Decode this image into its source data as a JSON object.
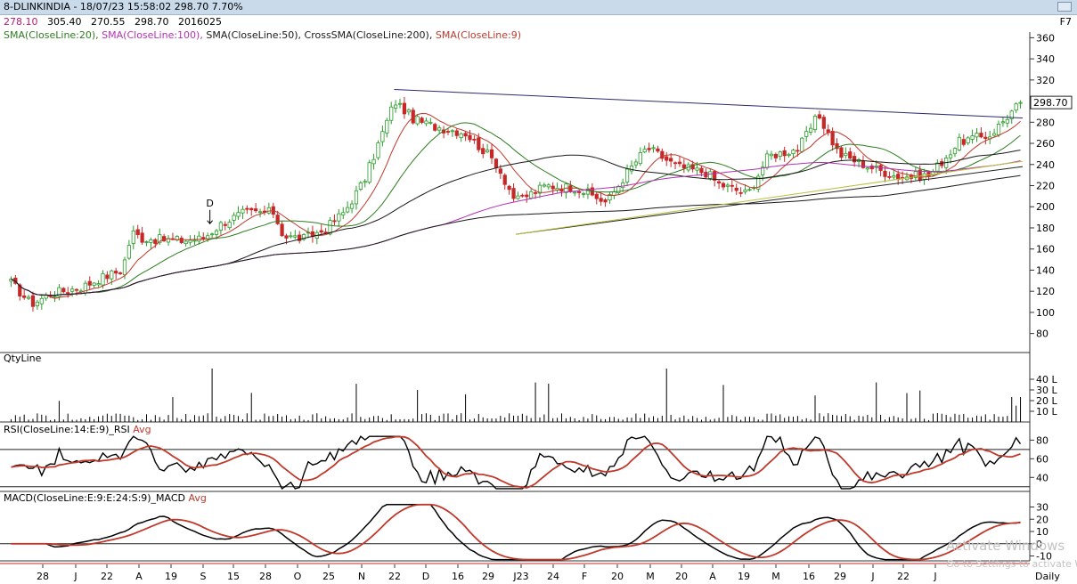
{
  "window": {
    "title": "8-DLINKINDIA - 18/07/23 15:58:02 298.70 7.70%"
  },
  "ohlc": {
    "open": "278.10",
    "high": "305.40",
    "low": "270.55",
    "close": "298.70",
    "volume": "2016025"
  },
  "shortcut": "F7",
  "indicators": [
    {
      "label": "SMA(CloseLine:20),",
      "color": "#2e7d1f"
    },
    {
      "label": "SMA(CloseLine:100),",
      "color": "#b531b5"
    },
    {
      "label": "SMA(CloseLine:50),",
      "color": "#1a1a1a"
    },
    {
      "label": "CrossSMA(CloseLine:200),",
      "color": "#1a1a1a"
    },
    {
      "label": "SMA(CloseLine:9)",
      "color": "#c0392b"
    }
  ],
  "panels": {
    "volume": "QtyLine",
    "rsi": {
      "name": "RSI(CloseLine:14:E:9)_RSI",
      "avg": "Avg"
    },
    "macd": {
      "name": "MACD(CloseLine:E:9:E:24:S:9)_MACD",
      "avg": "Avg"
    }
  },
  "annotation": "D",
  "timeframe": "Daily",
  "watermark": {
    "line1": "Activate Windows",
    "line2": "Go to Settings to activate Windows."
  },
  "colors": {
    "up": "#2a9d2a",
    "down": "#c62828",
    "signal": "#c0392b",
    "sma100": "#b531b5",
    "sma20": "#2e7d1f"
  },
  "chart_data": {
    "type": "candlestick",
    "price_axis": {
      "ticks": [
        80,
        100,
        120,
        140,
        160,
        180,
        200,
        220,
        240,
        260,
        280,
        300,
        320,
        340,
        360
      ],
      "range": [
        62,
        362
      ]
    },
    "last_price": "298.70",
    "x_ticks": [
      "28",
      "J",
      "22",
      "A",
      "19",
      "S",
      "15",
      "28",
      "O",
      "25",
      "N",
      "22",
      "D",
      "16",
      "29",
      "J23",
      "24",
      "F",
      "20",
      "M",
      "20",
      "A",
      "19",
      "M",
      "16",
      "29",
      "J",
      "22",
      "J"
    ],
    "price_path": [
      [
        0,
        128
      ],
      [
        0.02,
        108
      ],
      [
        0.04,
        118
      ],
      [
        0.07,
        124
      ],
      [
        0.09,
        133
      ],
      [
        0.11,
        140
      ],
      [
        0.12,
        176
      ],
      [
        0.13,
        170
      ],
      [
        0.17,
        168
      ],
      [
        0.19,
        170
      ],
      [
        0.21,
        185
      ],
      [
        0.23,
        194
      ],
      [
        0.26,
        195
      ],
      [
        0.27,
        172
      ],
      [
        0.29,
        170
      ],
      [
        0.31,
        178
      ],
      [
        0.33,
        195
      ],
      [
        0.35,
        225
      ],
      [
        0.37,
        275
      ],
      [
        0.38,
        300
      ],
      [
        0.4,
        282
      ],
      [
        0.42,
        276
      ],
      [
        0.45,
        270
      ],
      [
        0.48,
        242
      ],
      [
        0.5,
        205
      ],
      [
        0.53,
        220
      ],
      [
        0.56,
        218
      ],
      [
        0.59,
        204
      ],
      [
        0.61,
        232
      ],
      [
        0.63,
        256
      ],
      [
        0.66,
        238
      ],
      [
        0.69,
        232
      ],
      [
        0.7,
        222
      ],
      [
        0.73,
        212
      ],
      [
        0.75,
        248
      ],
      [
        0.78,
        255
      ],
      [
        0.8,
        287
      ],
      [
        0.82,
        250
      ],
      [
        0.85,
        238
      ],
      [
        0.88,
        228
      ],
      [
        0.91,
        230
      ],
      [
        0.94,
        262
      ],
      [
        0.97,
        268
      ],
      [
        1.0,
        298.7
      ]
    ],
    "trendlines": [
      {
        "from": [
          0.38,
          311
        ],
        "to": [
          1.0,
          284
        ]
      },
      {
        "from": [
          0.5,
          174
        ],
        "to": [
          1.0,
          238
        ]
      }
    ],
    "volume": {
      "ticks": [
        "10 L",
        "20 L",
        "30 L",
        "40 L"
      ]
    },
    "rsi": {
      "ticks": [
        40,
        60,
        80
      ],
      "levels": [
        30,
        70
      ],
      "range": [
        25,
        88
      ]
    },
    "macd": {
      "ticks": [
        -10,
        0,
        10,
        20,
        30
      ],
      "range": [
        -14,
        34
      ]
    }
  }
}
